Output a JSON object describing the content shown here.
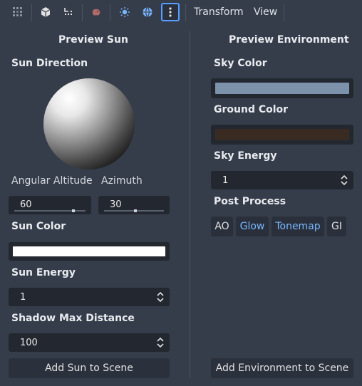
{
  "toolbar": {
    "buttons": [
      {
        "name": "grid-snap-icon"
      },
      {
        "name": "perspective-cube-icon"
      },
      {
        "name": "transform-gizmo-icon"
      },
      {
        "name": "audio-listener-icon"
      },
      {
        "name": "sun-toggle-icon"
      },
      {
        "name": "environment-toggle-icon"
      },
      {
        "name": "more-options-icon"
      }
    ],
    "menus": [
      "Transform",
      "View"
    ]
  },
  "sun": {
    "title": "Preview Sun",
    "direction_label": "Sun Direction",
    "altitude_label": "Angular Altitude",
    "azimuth_label": "Azimuth",
    "altitude_value": "60",
    "altitude_fraction": 0.83,
    "azimuth_value": "30",
    "azimuth_fraction": 0.52,
    "color_label": "Sun Color",
    "color": "#ffffff",
    "energy_label": "Sun Energy",
    "energy_value": "1",
    "shadow_label": "Shadow Max Distance",
    "shadow_value": "100",
    "add_button": "Add Sun to Scene"
  },
  "environment": {
    "title": "Preview Environment",
    "sky_color_label": "Sky Color",
    "sky_color": "#7c91aa",
    "ground_color_label": "Ground Color",
    "ground_color": "#3a2b22",
    "sky_energy_label": "Sky Energy",
    "sky_energy_value": "1",
    "post_process_label": "Post Process",
    "post_process": [
      {
        "label": "AO",
        "enabled": false
      },
      {
        "label": "Glow",
        "enabled": true
      },
      {
        "label": "Tonemap",
        "enabled": true
      },
      {
        "label": "GI",
        "enabled": false
      }
    ],
    "add_button": "Add Environment to Scene"
  },
  "colors": {
    "accent": "#569eff",
    "panel": "#363d4a",
    "field": "#232830"
  }
}
